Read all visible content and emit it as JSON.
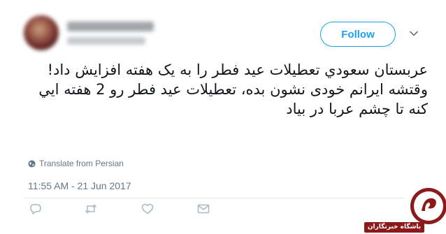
{
  "tweet": {
    "follow_label": "Follow",
    "text_lines": [
      "عربستان سعودي تعطيلات عيد فطر را به يک هفته افزايش داد!",
      "وقتشه ايرانم  خودی نشون بده، تعطيلات عيد فطر رو  2 هفته ايي کنه تا چشم عربا در بياد"
    ],
    "translate_label": "Translate from Persian",
    "timestamp": "11:55 AM - 21 Jun 2017"
  },
  "icons": {
    "more": "chevron-down-icon",
    "translate": "globe-icon",
    "reply": "reply-icon",
    "retweet": "retweet-icon",
    "like": "heart-icon",
    "message": "envelope-icon"
  },
  "watermark": {
    "label": "باشگاه خبرنگاران"
  },
  "colors": {
    "accent": "#1da1f2",
    "secondary_text": "#657786",
    "action_icon": "#aab8c2",
    "watermark_red": "#8c1a1a"
  }
}
